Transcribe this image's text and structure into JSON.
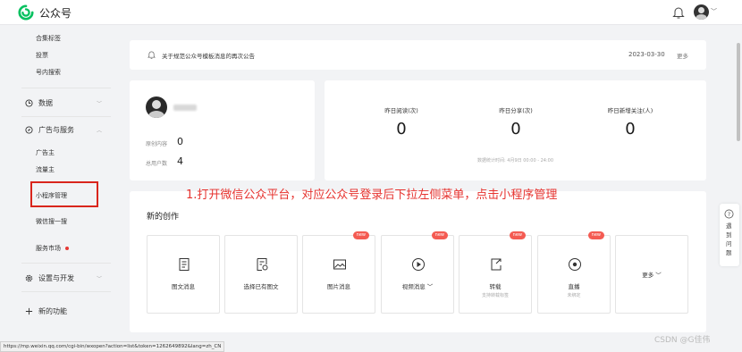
{
  "app": {
    "title": "公众号"
  },
  "sidebar": {
    "top_items": [
      "合集标签",
      "投票",
      "号内搜索"
    ],
    "data_group": "数据",
    "ads_group": "广告与服务",
    "ads_items": [
      "广告主",
      "流量主"
    ],
    "mini_program": "小程序管理",
    "wechat_search": "微信搜一搜",
    "service_market": "服务市场",
    "settings_group": "设置与开发",
    "new_feature": "新的功能"
  },
  "notice": {
    "text": "关于规范公众号模板消息的再次公告",
    "date": "2023-03-30",
    "more": "更多"
  },
  "profile": {
    "original_label": "原创内容",
    "original_value": "0",
    "users_label": "总用户数",
    "users_value": "4"
  },
  "stats": {
    "items": [
      {
        "label": "昨日阅读(次)",
        "value": "0"
      },
      {
        "label": "昨日分享(次)",
        "value": "0"
      },
      {
        "label": "昨日新增关注(人)",
        "value": "0"
      }
    ],
    "footer": "数据统计时间: 4月9日 00:00 - 24:00"
  },
  "annotation": "1.打开微信公众平台，对应公众号登录后下拉左侧菜单，点击小程序管理",
  "create": {
    "title": "新的创作",
    "tiles": [
      {
        "label": "图文消息",
        "sub": "",
        "badge": "",
        "icon": "document-icon"
      },
      {
        "label": "选择已有图文",
        "sub": "",
        "badge": "",
        "icon": "document-select-icon"
      },
      {
        "label": "图片消息",
        "sub": "",
        "badge": "new",
        "icon": "image-icon"
      },
      {
        "label": "视频消息 ﹀",
        "sub": "",
        "badge": "new",
        "icon": "play-icon"
      },
      {
        "label": "转载",
        "sub": "支持转载标签",
        "badge": "new",
        "icon": "repost-icon"
      },
      {
        "label": "直播",
        "sub": "未绑定",
        "badge": "new",
        "icon": "live-icon"
      },
      {
        "label": "更多 ﹀",
        "sub": "",
        "badge": "",
        "icon": ""
      }
    ]
  },
  "right_widget": {
    "text": "遇到问题"
  },
  "status_url": "https://mp.weixin.qq.com/cgi-bin/wxopen?action=list&token=1262649892&lang=zh_CN",
  "watermark": "CSDN @G佳伟",
  "colors": {
    "brand_green": "#07c160",
    "annotation_red": "#e6322e",
    "badge_red": "#f45b52"
  }
}
